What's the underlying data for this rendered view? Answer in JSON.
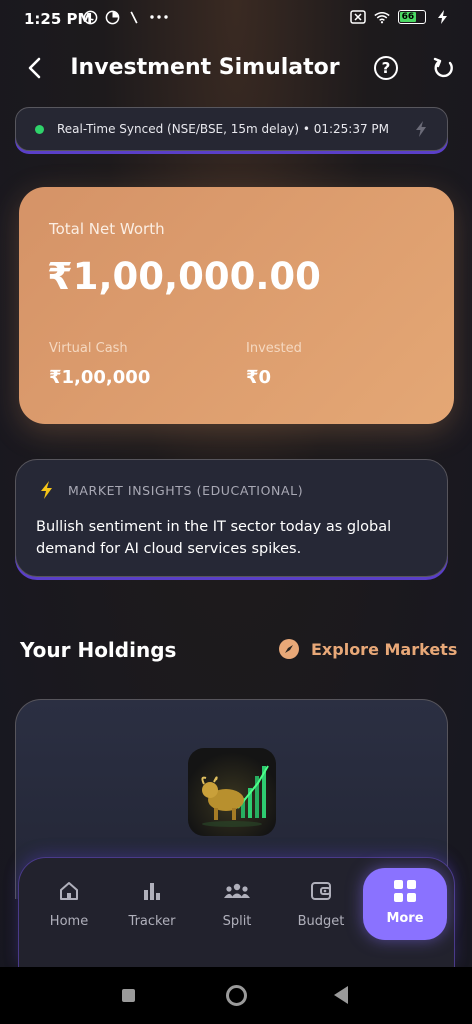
{
  "status_bar": {
    "time": "1:25 PM",
    "battery": "66"
  },
  "header": {
    "title": "Investment Simulator"
  },
  "sync": {
    "text": "Real-Time Synced (NSE/BSE, 15m delay) • 01:25:37 PM",
    "color": "#2fd36b"
  },
  "net_worth": {
    "label": "Total Net Worth",
    "value": "₹1,00,000.00",
    "virtual_cash_label": "Virtual Cash",
    "virtual_cash_value": "₹1,00,000",
    "invested_label": "Invested",
    "invested_value": "₹0"
  },
  "insights": {
    "title": "MARKET INSIGHTS (EDUCATIONAL)",
    "text": "Bullish sentiment in the IT sector today as global demand for AI cloud services spikes."
  },
  "holdings": {
    "title": "Your Holdings",
    "explore_label": "Explore Markets"
  },
  "bottom_nav": {
    "items": [
      {
        "label": "Home",
        "icon": "home-icon"
      },
      {
        "label": "Tracker",
        "icon": "bar-chart-icon"
      },
      {
        "label": "Split",
        "icon": "group-icon"
      },
      {
        "label": "Budget",
        "icon": "wallet-icon"
      },
      {
        "label": "More",
        "icon": "grid-icon",
        "active": true
      }
    ]
  },
  "colors": {
    "accent": "#8a72ff",
    "card": "#e4a775",
    "link": "#e8a878"
  }
}
